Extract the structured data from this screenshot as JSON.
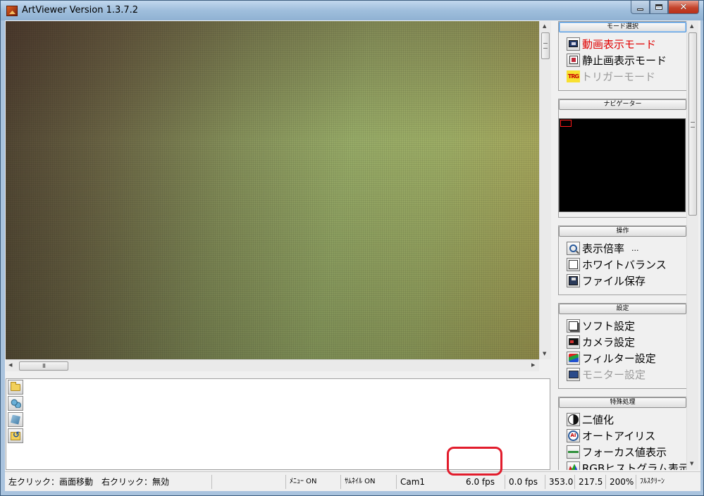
{
  "window": {
    "title": "ArtViewer Version 1.3.7.2",
    "close_glyph": "✕"
  },
  "mode_group": {
    "header": "モード選択",
    "items": [
      {
        "label": "動画表示モード",
        "icon": "video-monitor-icon",
        "state": "active",
        "color": "#e00000"
      },
      {
        "label": "静止画表示モード",
        "icon": "still-image-icon",
        "state": "normal"
      },
      {
        "label": "トリガーモード",
        "icon": "trigger-icon",
        "icon_text": "TRG",
        "state": "disabled"
      }
    ]
  },
  "navigator": {
    "header": "ナビゲーター"
  },
  "operation_group": {
    "header": "操作",
    "items": [
      {
        "label": "表示倍率",
        "suffix": "...",
        "icon": "magnifier-icon"
      },
      {
        "label": "ホワイトバランス",
        "icon": "white-balance-icon"
      },
      {
        "label": "ファイル保存",
        "icon": "floppy-disk-icon"
      }
    ]
  },
  "settings_group": {
    "header": "設定",
    "items": [
      {
        "label": "ソフト設定",
        "icon": "software-settings-icon",
        "state": "normal"
      },
      {
        "label": "カメラ設定",
        "icon": "camera-settings-icon",
        "state": "normal"
      },
      {
        "label": "フィルター設定",
        "icon": "filter-settings-icon",
        "state": "normal"
      },
      {
        "label": "モニター設定",
        "icon": "monitor-settings-icon",
        "state": "disabled"
      }
    ]
  },
  "special_group": {
    "header": "特殊処理",
    "items": [
      {
        "label": "二値化",
        "icon": "binarize-icon"
      },
      {
        "label": "オートアイリス",
        "icon": "auto-iris-icon",
        "icon_text": "AI"
      },
      {
        "label": "フォーカス値表示",
        "icon": "focus-value-icon"
      },
      {
        "label": "RGBヒストグラム表示",
        "icon": "rgb-histogram-icon"
      }
    ]
  },
  "tool_icons": [
    "folder-icon",
    "multi-camera-icon",
    "camera-icon",
    "refresh-folder-icon"
  ],
  "scroll": {
    "hthumb_label": "III"
  },
  "statusbar": {
    "click_hint": "左クリック：画面移動　右クリック：無効",
    "menu": "ﾒﾆｭｰ ON",
    "thumbnail": "ｻﾑﾈｲﾙ ON",
    "camera": "Cam1",
    "fps_display": "6.0 fps",
    "fps_save": "0.0 fps",
    "value_1": "353.0",
    "value_2": "217.5",
    "zoom": "200%",
    "fullscreen": "ﾌﾙｽｸﾘｰﾝ"
  },
  "colors": {
    "highlight_ring": "#e21c2c",
    "active_mode": "#e00000",
    "disabled_text": "#9a9a9a"
  }
}
